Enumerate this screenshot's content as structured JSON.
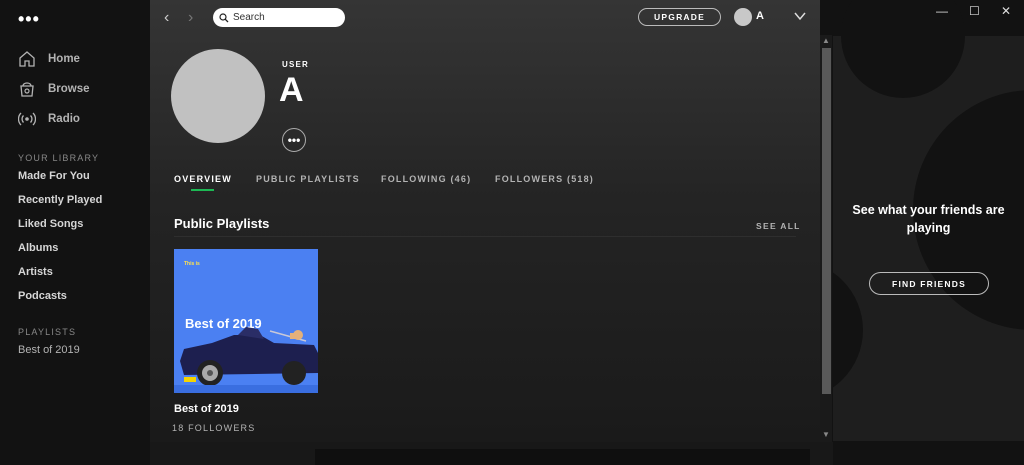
{
  "sidebar": {
    "menu_dots": "•••",
    "nav": [
      {
        "label": "Home",
        "icon": "home-icon"
      },
      {
        "label": "Browse",
        "icon": "browse-icon"
      },
      {
        "label": "Radio",
        "icon": "radio-icon"
      }
    ],
    "library_heading": "YOUR LIBRARY",
    "library": [
      "Made For You",
      "Recently Played",
      "Liked Songs",
      "Albums",
      "Artists",
      "Podcasts"
    ],
    "playlists_heading": "PLAYLISTS",
    "playlists": [
      "Best of 2019"
    ]
  },
  "topbar": {
    "back": "‹",
    "forward": "›",
    "search_placeholder": "Search",
    "upgrade": "UPGRADE",
    "user": "A"
  },
  "profile": {
    "type_label": "USER",
    "name": "A",
    "more": "•••"
  },
  "tabs": [
    {
      "label": "OVERVIEW",
      "active": true
    },
    {
      "label": "PUBLIC PLAYLISTS",
      "active": false
    },
    {
      "label": "FOLLOWING (46)",
      "active": false
    },
    {
      "label": "FOLLOWERS (518)",
      "active": false
    }
  ],
  "section": {
    "title": "Public Playlists",
    "see_all": "SEE ALL"
  },
  "playlist_card": {
    "cover_tag": "This is",
    "cover_title": "Best of 2019",
    "title": "Best of 2019",
    "followers": "18 FOLLOWERS"
  },
  "friends": {
    "message": "See what your friends are playing",
    "button": "FIND FRIENDS"
  },
  "window": {
    "minimize": "—",
    "maximize": "☐",
    "close": "✕"
  },
  "colors": {
    "accent": "#1db954",
    "cover_bg": "#4b80f2"
  }
}
